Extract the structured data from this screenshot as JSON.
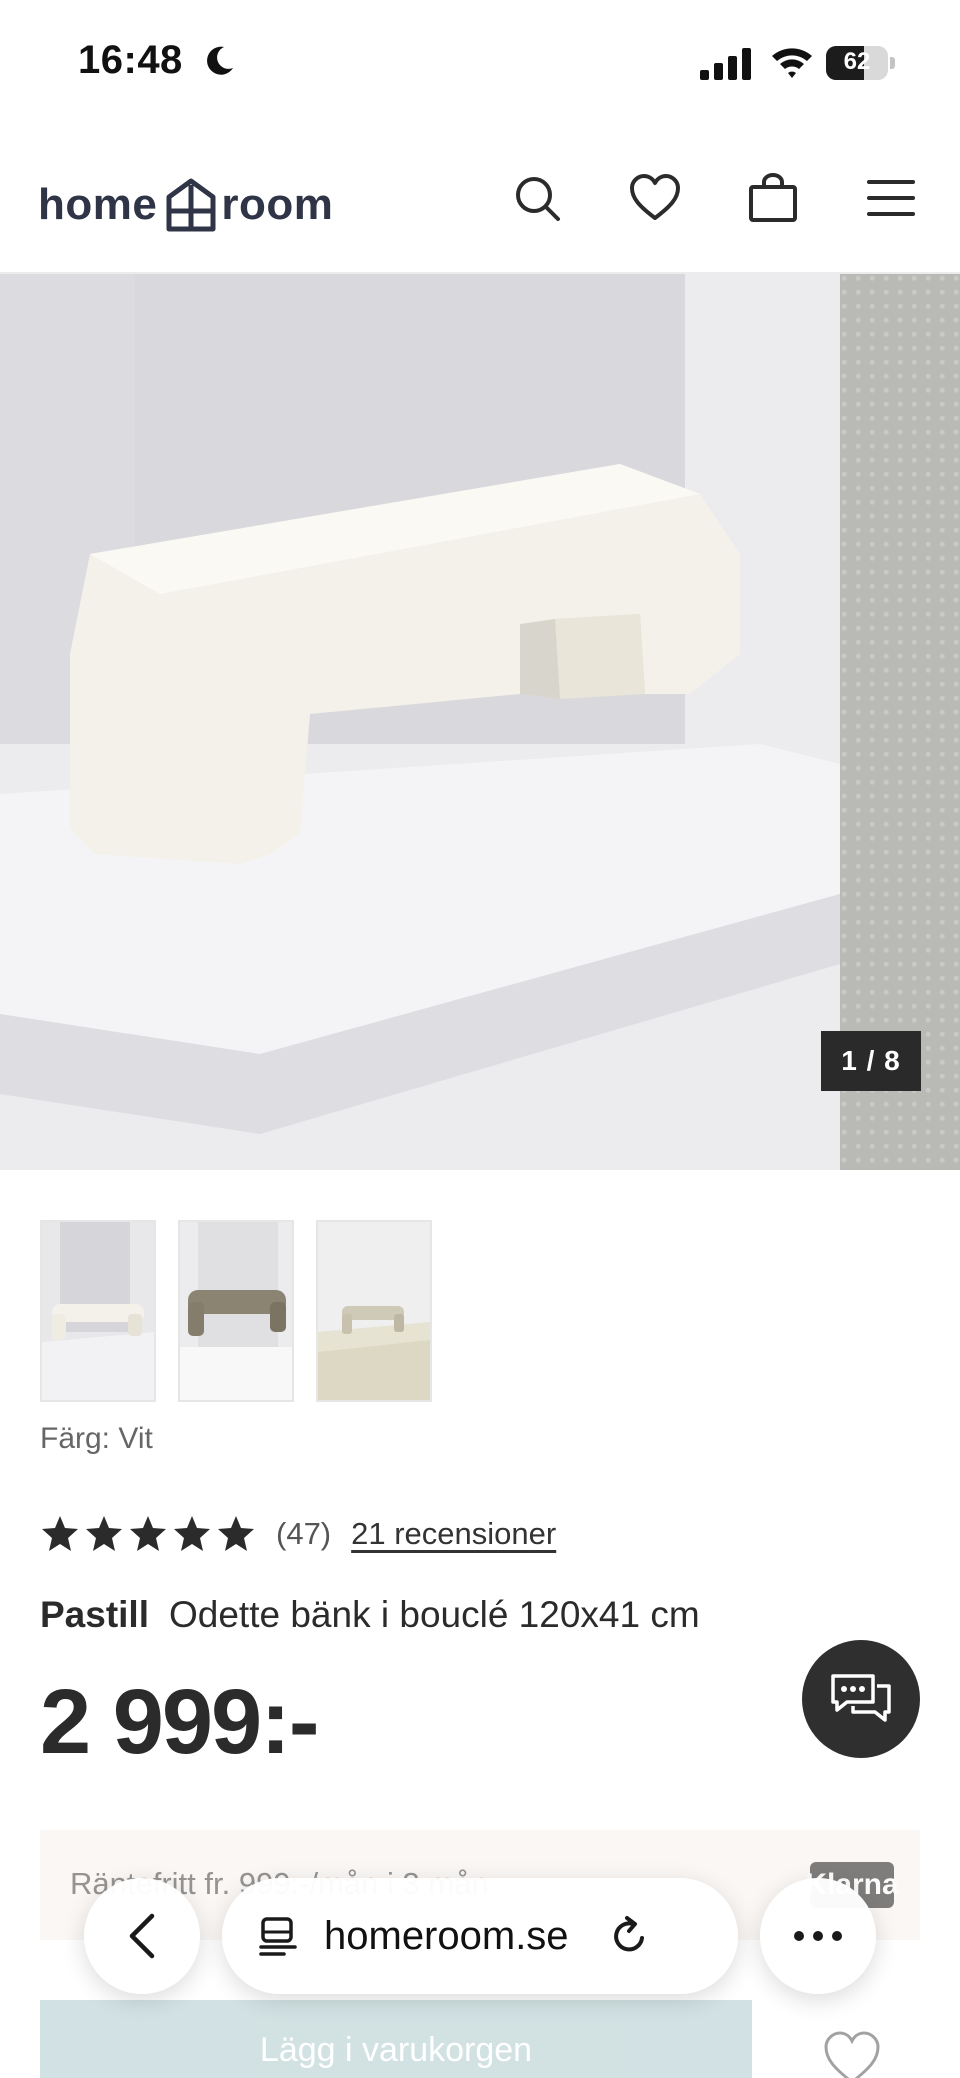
{
  "status_bar": {
    "time": "16:48",
    "battery_percent": "62",
    "icons": [
      "moon-icon",
      "cellular-signal-icon",
      "wifi-icon",
      "battery-icon"
    ]
  },
  "header": {
    "logo_left": "home",
    "logo_right": "room",
    "icons": [
      "search-icon",
      "heart-icon",
      "shopping-bag-icon",
      "menu-icon"
    ]
  },
  "gallery": {
    "counter": "1 / 8",
    "current": 1,
    "total": 8
  },
  "product": {
    "color_label": "Färg: Vit",
    "rating_value": 5,
    "rating_max": 5,
    "rating_count": "(47)",
    "reviews_link": "21 recensioner",
    "brand": "Pastill",
    "name": "Odette bänk i bouclé 120x41 cm",
    "price": "2 999:-"
  },
  "installment": {
    "text": "Räntefritt fr. 999:-/mån i 3 mån",
    "badge": "Klarna"
  },
  "cart": {
    "button_label": "Lägg i varukorgen"
  },
  "browser": {
    "url": "homeroom.se"
  },
  "colors": {
    "brand_dark": "#2f3446",
    "price_text": "#2b2b2b",
    "cart_button": "#bfd6d8",
    "chat_button": "#2f2f2f"
  }
}
